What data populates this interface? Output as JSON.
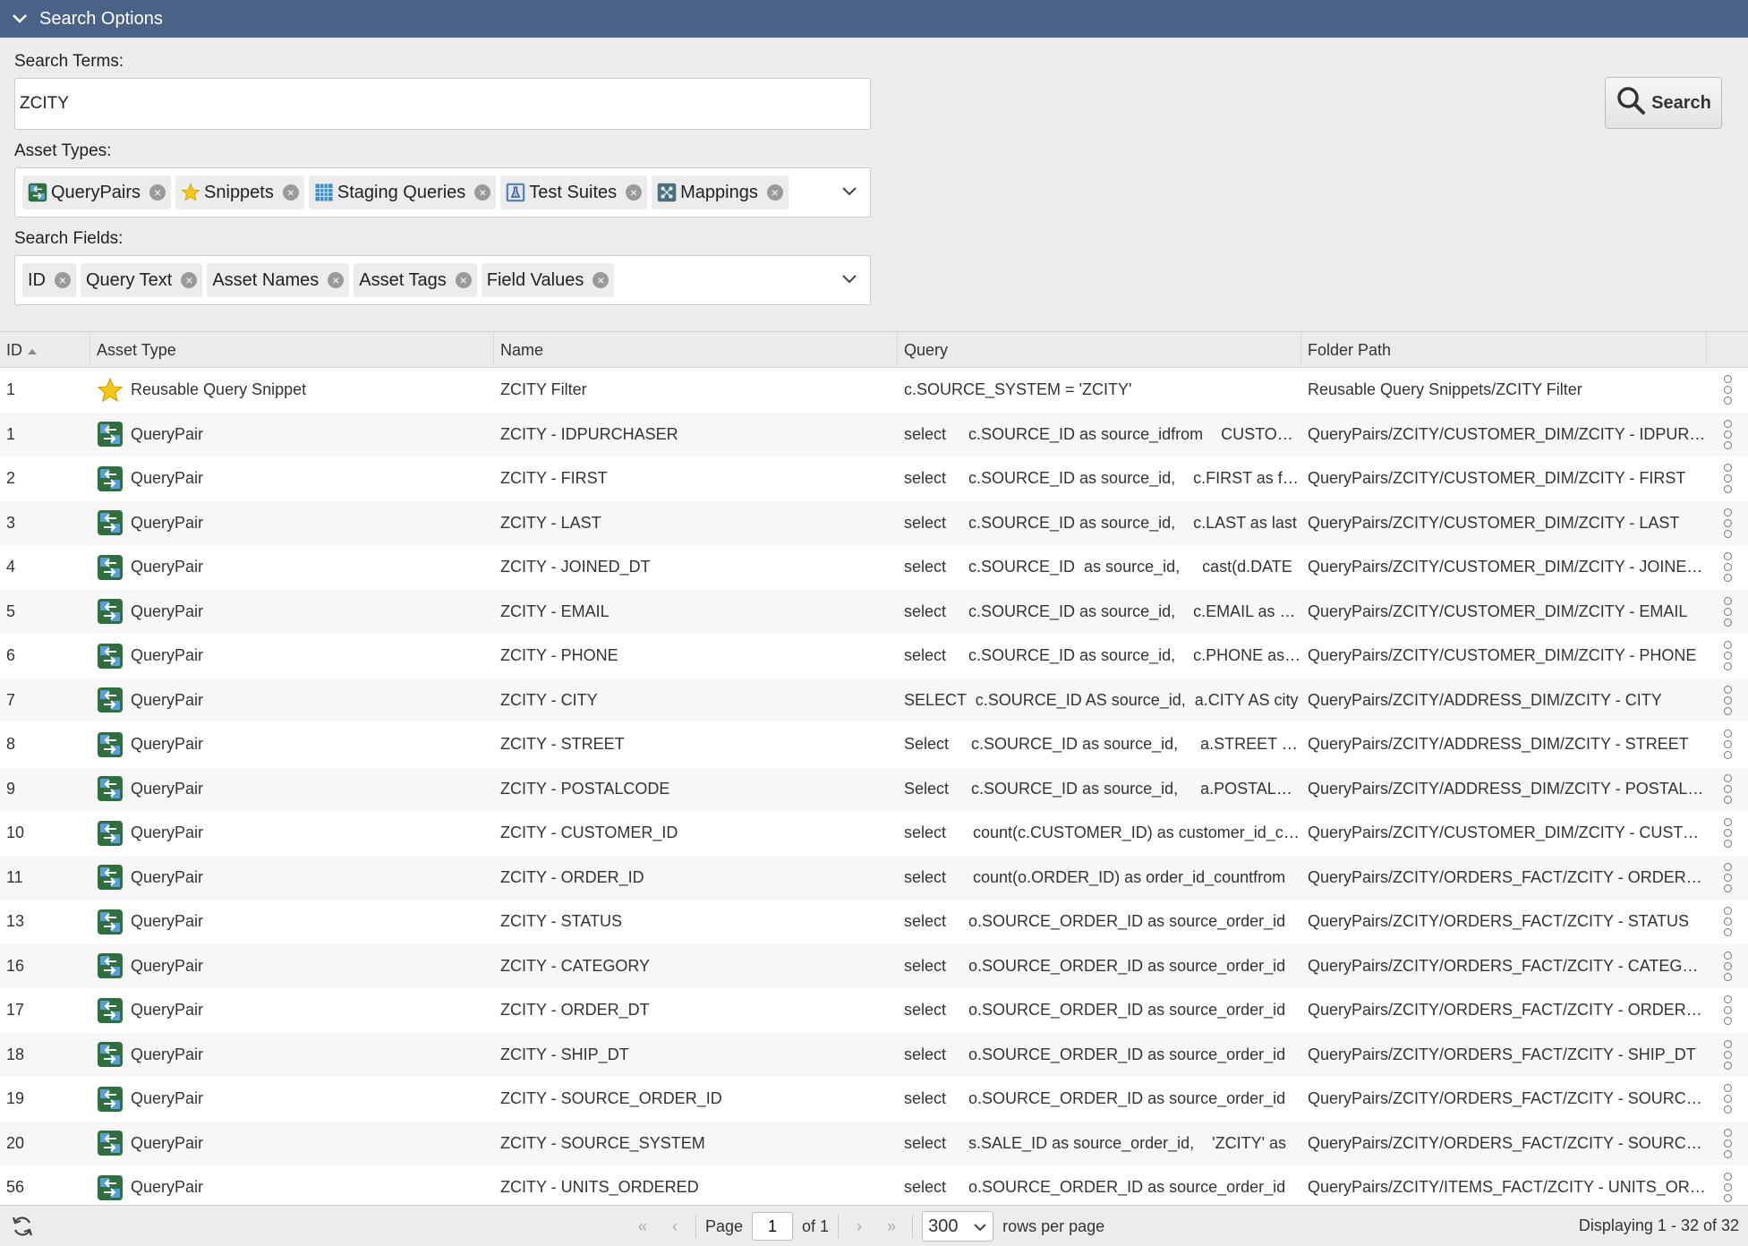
{
  "header": {
    "title": "Search Options"
  },
  "search": {
    "terms_label": "Search Terms:",
    "terms_value": "ZCITY",
    "button_label": "Search",
    "asset_types_label": "Asset Types:",
    "asset_types": [
      {
        "label": "QueryPairs",
        "icon": "querypair-icon"
      },
      {
        "label": "Snippets",
        "icon": "star-icon"
      },
      {
        "label": "Staging Queries",
        "icon": "grid-icon"
      },
      {
        "label": "Test Suites",
        "icon": "flask-icon"
      },
      {
        "label": "Mappings",
        "icon": "mapping-icon"
      }
    ],
    "search_fields_label": "Search Fields:",
    "search_fields": [
      "ID",
      "Query Text",
      "Asset Names",
      "Asset Tags",
      "Field Values"
    ]
  },
  "grid": {
    "columns": [
      "ID",
      "Asset Type",
      "Name",
      "Query",
      "Folder Path"
    ],
    "sort": {
      "column": "ID",
      "direction": "asc"
    },
    "rows": [
      {
        "id": "1",
        "type": "Reusable Query Snippet",
        "icon": "star-icon",
        "name": "ZCITY Filter",
        "query": "c.SOURCE_SYSTEM = 'ZCITY'",
        "folder": "Reusable Query Snippets/ZCITY Filter"
      },
      {
        "id": "1",
        "type": "QueryPair",
        "icon": "querypair-icon",
        "name": "ZCITY - IDPURCHASER",
        "query": "select     c.SOURCE_ID as source_idfrom    CUSTOMER",
        "folder": "QueryPairs/ZCITY/CUSTOMER_DIM/ZCITY - IDPURCHASER"
      },
      {
        "id": "2",
        "type": "QueryPair",
        "icon": "querypair-icon",
        "name": "ZCITY - FIRST",
        "query": "select     c.SOURCE_ID as source_id,    c.FIRST as first",
        "folder": "QueryPairs/ZCITY/CUSTOMER_DIM/ZCITY - FIRST"
      },
      {
        "id": "3",
        "type": "QueryPair",
        "icon": "querypair-icon",
        "name": "ZCITY - LAST",
        "query": "select     c.SOURCE_ID as source_id,    c.LAST as last",
        "folder": "QueryPairs/ZCITY/CUSTOMER_DIM/ZCITY - LAST"
      },
      {
        "id": "4",
        "type": "QueryPair",
        "icon": "querypair-icon",
        "name": "ZCITY - JOINED_DT",
        "query": "select     c.SOURCE_ID  as source_id,     cast(d.DATE",
        "folder": "QueryPairs/ZCITY/CUSTOMER_DIM/ZCITY - JOINED_DT"
      },
      {
        "id": "5",
        "type": "QueryPair",
        "icon": "querypair-icon",
        "name": "ZCITY - EMAIL",
        "query": "select     c.SOURCE_ID as source_id,    c.EMAIL as email",
        "folder": "QueryPairs/ZCITY/CUSTOMER_DIM/ZCITY - EMAIL"
      },
      {
        "id": "6",
        "type": "QueryPair",
        "icon": "querypair-icon",
        "name": "ZCITY - PHONE",
        "query": "select     c.SOURCE_ID as source_id,    c.PHONE as phone",
        "folder": "QueryPairs/ZCITY/CUSTOMER_DIM/ZCITY - PHONE"
      },
      {
        "id": "7",
        "type": "QueryPair",
        "icon": "querypair-icon",
        "name": "ZCITY - CITY",
        "query": "SELECT  c.SOURCE_ID AS source_id,  a.CITY AS city",
        "folder": "QueryPairs/ZCITY/ADDRESS_DIM/ZCITY - CITY"
      },
      {
        "id": "8",
        "type": "QueryPair",
        "icon": "querypair-icon",
        "name": "ZCITY - STREET",
        "query": "Select     c.SOURCE_ID as source_id,     a.STREET as street",
        "folder": "QueryPairs/ZCITY/ADDRESS_DIM/ZCITY - STREET"
      },
      {
        "id": "9",
        "type": "QueryPair",
        "icon": "querypair-icon",
        "name": "ZCITY - POSTALCODE",
        "query": "Select     c.SOURCE_ID as source_id,     a.POSTALCODE",
        "folder": "QueryPairs/ZCITY/ADDRESS_DIM/ZCITY - POSTALCODE"
      },
      {
        "id": "10",
        "type": "QueryPair",
        "icon": "querypair-icon",
        "name": "ZCITY - CUSTOMER_ID",
        "query": "select      count(c.CUSTOMER_ID) as customer_id_count",
        "folder": "QueryPairs/ZCITY/CUSTOMER_DIM/ZCITY - CUSTOMER_ID"
      },
      {
        "id": "11",
        "type": "QueryPair",
        "icon": "querypair-icon",
        "name": "ZCITY - ORDER_ID",
        "query": "select      count(o.ORDER_ID) as order_id_countfrom",
        "folder": "QueryPairs/ZCITY/ORDERS_FACT/ZCITY - ORDER_ID"
      },
      {
        "id": "13",
        "type": "QueryPair",
        "icon": "querypair-icon",
        "name": "ZCITY - STATUS",
        "query": "select     o.SOURCE_ORDER_ID as source_order_id",
        "folder": "QueryPairs/ZCITY/ORDERS_FACT/ZCITY - STATUS"
      },
      {
        "id": "16",
        "type": "QueryPair",
        "icon": "querypair-icon",
        "name": "ZCITY - CATEGORY",
        "query": "select     o.SOURCE_ORDER_ID as source_order_id",
        "folder": "QueryPairs/ZCITY/ORDERS_FACT/ZCITY - CATEGORY"
      },
      {
        "id": "17",
        "type": "QueryPair",
        "icon": "querypair-icon",
        "name": "ZCITY - ORDER_DT",
        "query": "select     o.SOURCE_ORDER_ID as source_order_id",
        "folder": "QueryPairs/ZCITY/ORDERS_FACT/ZCITY - ORDER_DT"
      },
      {
        "id": "18",
        "type": "QueryPair",
        "icon": "querypair-icon",
        "name": "ZCITY - SHIP_DT",
        "query": "select     o.SOURCE_ORDER_ID as source_order_id",
        "folder": "QueryPairs/ZCITY/ORDERS_FACT/ZCITY - SHIP_DT"
      },
      {
        "id": "19",
        "type": "QueryPair",
        "icon": "querypair-icon",
        "name": "ZCITY - SOURCE_ORDER_ID",
        "query": "select     o.SOURCE_ORDER_ID as source_order_id",
        "folder": "QueryPairs/ZCITY/ORDERS_FACT/ZCITY - SOURCE_ORDER_ID"
      },
      {
        "id": "20",
        "type": "QueryPair",
        "icon": "querypair-icon",
        "name": "ZCITY - SOURCE_SYSTEM",
        "query": "select     s.SALE_ID as source_order_id,    'ZCITY' as",
        "folder": "QueryPairs/ZCITY/ORDERS_FACT/ZCITY - SOURCE_SYSTEM"
      },
      {
        "id": "56",
        "type": "QueryPair",
        "icon": "querypair-icon",
        "name": "ZCITY - UNITS_ORDERED",
        "query": "select     o.SOURCE_ORDER_ID as source_order_id",
        "folder": "QueryPairs/ZCITY/ITEMS_FACT/ZCITY - UNITS_ORDERED"
      }
    ]
  },
  "footer": {
    "page_label": "Page",
    "page_value": "1",
    "of_label": "of 1",
    "rows_per_page_value": "300",
    "rows_per_page_label": "rows per page",
    "displaying": "Displaying 1 - 32 of 32"
  }
}
